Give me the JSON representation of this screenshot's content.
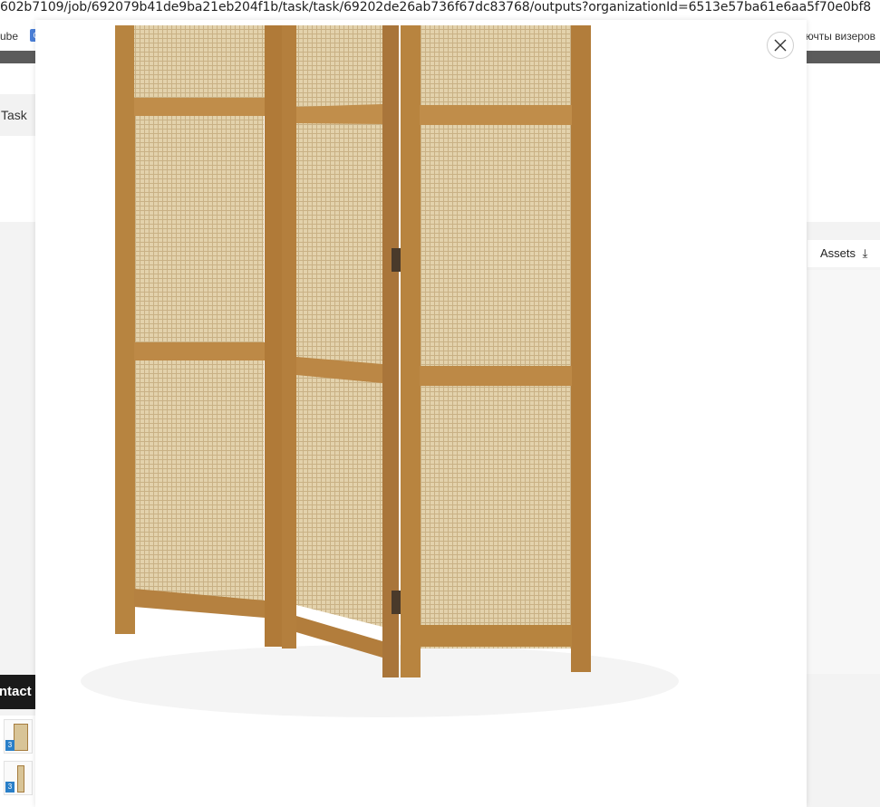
{
  "browser": {
    "url": "602b7109/job/692079b41de9ba21eb204f1b/task/task/69202de26ab736f67dc83768/outputs?organizationId=6513e57ba61e6aa5f70e0bf8",
    "bookmark_left": "ube",
    "bookmark_icon": "G",
    "bookmark_right": "ючты визеров"
  },
  "app": {
    "tab_label": "Task",
    "assets_label": "Assets",
    "contact_label": "ntact F",
    "thumb_badge": "3"
  },
  "modal": {
    "image_subject": "folding room divider with cane panels",
    "colors": {
      "wood": "#b8843f",
      "cane": "#ddc9a0",
      "hinge": "#4a3a2a"
    }
  }
}
